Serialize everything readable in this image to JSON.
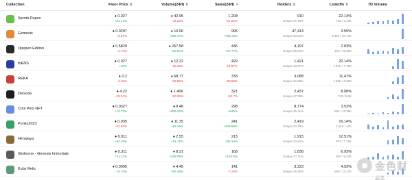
{
  "header": {
    "collection": "Collection",
    "floor_price": "Floor Price",
    "volume": "Volume(24H)",
    "sales": "Sales(24H)",
    "holders": "Holders",
    "listed": "Listed%",
    "seven_day": "7D Volume"
  },
  "colors": {
    "positive": "#1fa55a",
    "negative": "#e23b3b",
    "spark": "#7aa0e8"
  },
  "rows": [
    {
      "name": "Sproto Pepes",
      "avatar_color": "#6bbf4a",
      "floor": "♦ 0.027",
      "floor_chg": "+31.71%",
      "floor_dir": "pos",
      "vol": "♦ 42.95",
      "vol_chg": "-43.23%",
      "vol_dir": "neg",
      "sales": "1,208",
      "sales_chg": "-67.22%",
      "sales_dir": "neg",
      "holders": "910",
      "unique": "Unique 27.33%",
      "listed": "22.14%",
      "listed_sub": "738 / 3.33K",
      "spark": [
        0.15,
        0.2,
        0.3,
        0.25,
        0.4,
        0.35,
        0.5,
        1.0
      ]
    },
    {
      "name": "Gemesis",
      "avatar_color": "#e08a3a",
      "floor": "♦ 0.0297",
      "floor_chg": "-5.87%",
      "floor_dir": "neg",
      "vol": "♦ 10.06",
      "vol_chg": "+585.47%",
      "vol_dir": "pos",
      "sales": "995",
      "sales_chg": "+736.13%",
      "sales_dir": "pos",
      "holders": "47,413",
      "unique": "Unique 50.04%",
      "listed": "3.55%",
      "listed_sub": "3.36K / 94.74K",
      "spark": [
        0,
        0,
        0,
        0,
        0,
        0,
        0,
        1.0
      ]
    },
    {
      "name": "Opepen Edition",
      "avatar_color": "#2a2a2a",
      "floor": "♦ 0.5829",
      "floor_chg": "-4.73%",
      "floor_dir": "neg",
      "vol": "♦ 267.58",
      "vol_chg": "+15.54%",
      "vol_dir": "pos",
      "sales": "436",
      "sales_chg": "+37.77%",
      "sales_dir": "pos",
      "holders": "4,197",
      "unique": "Unique 25.84%",
      "listed": "2.83%",
      "listed_sub": "460 / 16.25K",
      "spark": [
        0.45,
        0.2,
        0.3,
        0.35,
        0.25,
        0.6,
        0.5,
        0.7
      ]
    },
    {
      "name": "friENS",
      "avatar_color": "#2c3e9c",
      "floor": "♦ 0.027",
      "floor_chg": "+35%",
      "floor_dir": "pos",
      "vol": "♦ 12.22",
      "vol_chg": "-25.36%",
      "vol_dir": "neg",
      "sales": "429",
      "sales_chg": "-24.87%",
      "sales_dir": "neg",
      "holders": "1,421",
      "unique": "Unique 18.27%",
      "listed": "20.14%",
      "listed_sub": "1.57K / 7.78K",
      "spark": [
        0,
        0,
        0,
        0,
        0,
        0.3,
        1.0,
        0.8
      ]
    },
    {
      "name": "REKA",
      "avatar_color": "#c9403a",
      "floor": "♦ 0.2",
      "floor_chg": "-4.46%",
      "floor_dir": "neg",
      "vol": "♦ 68.77",
      "vol_chg": "-92.55%",
      "vol_dir": "neg",
      "sales": "333",
      "sales_chg": "-89.58%",
      "sales_dir": "neg",
      "holders": "3,088",
      "unique": "Unique 33.28%",
      "listed": "11.47%",
      "listed_sub": "1.06K / 9.28K",
      "spark": [
        0,
        0,
        0,
        0,
        0,
        0.25,
        0.7,
        0.9
      ]
    },
    {
      "name": "DeGods",
      "avatar_color": "#1e1e1e",
      "floor": "♦ 4.22",
      "floor_chg": "-18.01%",
      "floor_dir": "neg",
      "vol": "♦ 1.46K",
      "vol_chg": "-90.28%",
      "vol_dir": "neg",
      "sales": "321",
      "sales_chg": "-92.7%",
      "sales_dir": "neg",
      "holders": "2,437",
      "unique": "Unique 27.39%",
      "listed": "8.08%",
      "listed_sub": "719 / 8.9K",
      "spark": [
        0,
        0,
        0,
        0,
        0.2,
        0.5,
        0.3,
        1.0
      ]
    },
    {
      "name": "Cool Pets NFT",
      "avatar_color": "#6a8fd8",
      "floor": "♦ 0.0327",
      "floor_chg": "+13.72%",
      "floor_dir": "pos",
      "vol": "♦ 9.48",
      "vol_chg": "+505.22%",
      "vol_dir": "pos",
      "sales": "298",
      "sales_chg": "+645%",
      "sales_dir": "pos",
      "holders": "8,774",
      "unique": "Unique 45.31%",
      "listed": "3.53%",
      "listed_sub": "684 / 19.36K",
      "spark": [
        0.1,
        0.15,
        0.1,
        0.2,
        0.15,
        0.3,
        0.2,
        1.0
      ]
    },
    {
      "name": "Punks2023",
      "avatar_color": "#3aa06a",
      "floor": "♦ 0.035",
      "floor_chg": "-22.52%",
      "floor_dir": "neg",
      "vol": "♦ 11.25",
      "vol_chg": "+18.16%",
      "vol_dir": "pos",
      "sales": "241",
      "sales_chg": "+449.69%",
      "sales_dir": "pos",
      "holders": "2,419",
      "unique": "Unique 24.19%",
      "listed": "16.14%",
      "listed_sub": "1.61K / 10K",
      "spark": [
        0.5,
        0.3,
        0.4,
        0.2,
        0.9,
        0.3,
        0.4,
        0.5
      ]
    },
    {
      "name": "Himalaya",
      "avatar_color": "#8a6a3a",
      "floor": "♦ 0.011",
      "floor_chg": "+34.15%",
      "floor_dir": "pos",
      "vol": "♦ 2.55",
      "vol_chg": "+61.11%",
      "vol_dir": "pos",
      "sales": "213",
      "sales_chg": "+55.16%",
      "sales_dir": "pos",
      "holders": "1,915",
      "unique": "Unique 24.62%",
      "listed": "12.51%",
      "listed_sub": "973 / 7.78K",
      "spark": [
        0,
        0,
        0,
        0,
        0.4,
        0.5,
        0.8,
        0.6
      ]
    },
    {
      "name": "Skyborne - Genesis Immortals",
      "avatar_color": "#5a5a5a",
      "floor": "♦ 0.311",
      "floor_chg": "+11.11%",
      "floor_dir": "pos",
      "vol": "♦ 8.21",
      "vol_chg": "+289.05%",
      "vol_dir": "pos",
      "sales": "168",
      "sales_chg": "+152.5%",
      "sales_dir": "pos",
      "holders": "1,838",
      "unique": "Unique 27.11%",
      "listed": "6.93%",
      "listed_sub": "640 / 9.23K",
      "spark": [
        0.2,
        0.3,
        0.6,
        0.3,
        0.4,
        0.5,
        0.3,
        0.8
      ]
    },
    {
      "name": "Kubz Relic",
      "avatar_color": "#5c9a7a",
      "floor": "♦ 0.0095",
      "floor_chg": "+6.74%",
      "floor_dir": "pos",
      "vol": "♦ 4.45",
      "vol_chg": "+55.49%",
      "vol_dir": "pos",
      "sales": "141",
      "sales_chg": "-7.24%",
      "sales_dir": "neg",
      "holders": "3,223",
      "unique": "Unique 26.49%",
      "listed": "4.93%",
      "listed_sub": "600 / 12.17K",
      "spark": [
        0,
        0,
        0,
        0,
        0.2,
        0.5,
        0.3,
        0.6
      ]
    }
  ],
  "watermark": {
    "text": "金色财经"
  }
}
